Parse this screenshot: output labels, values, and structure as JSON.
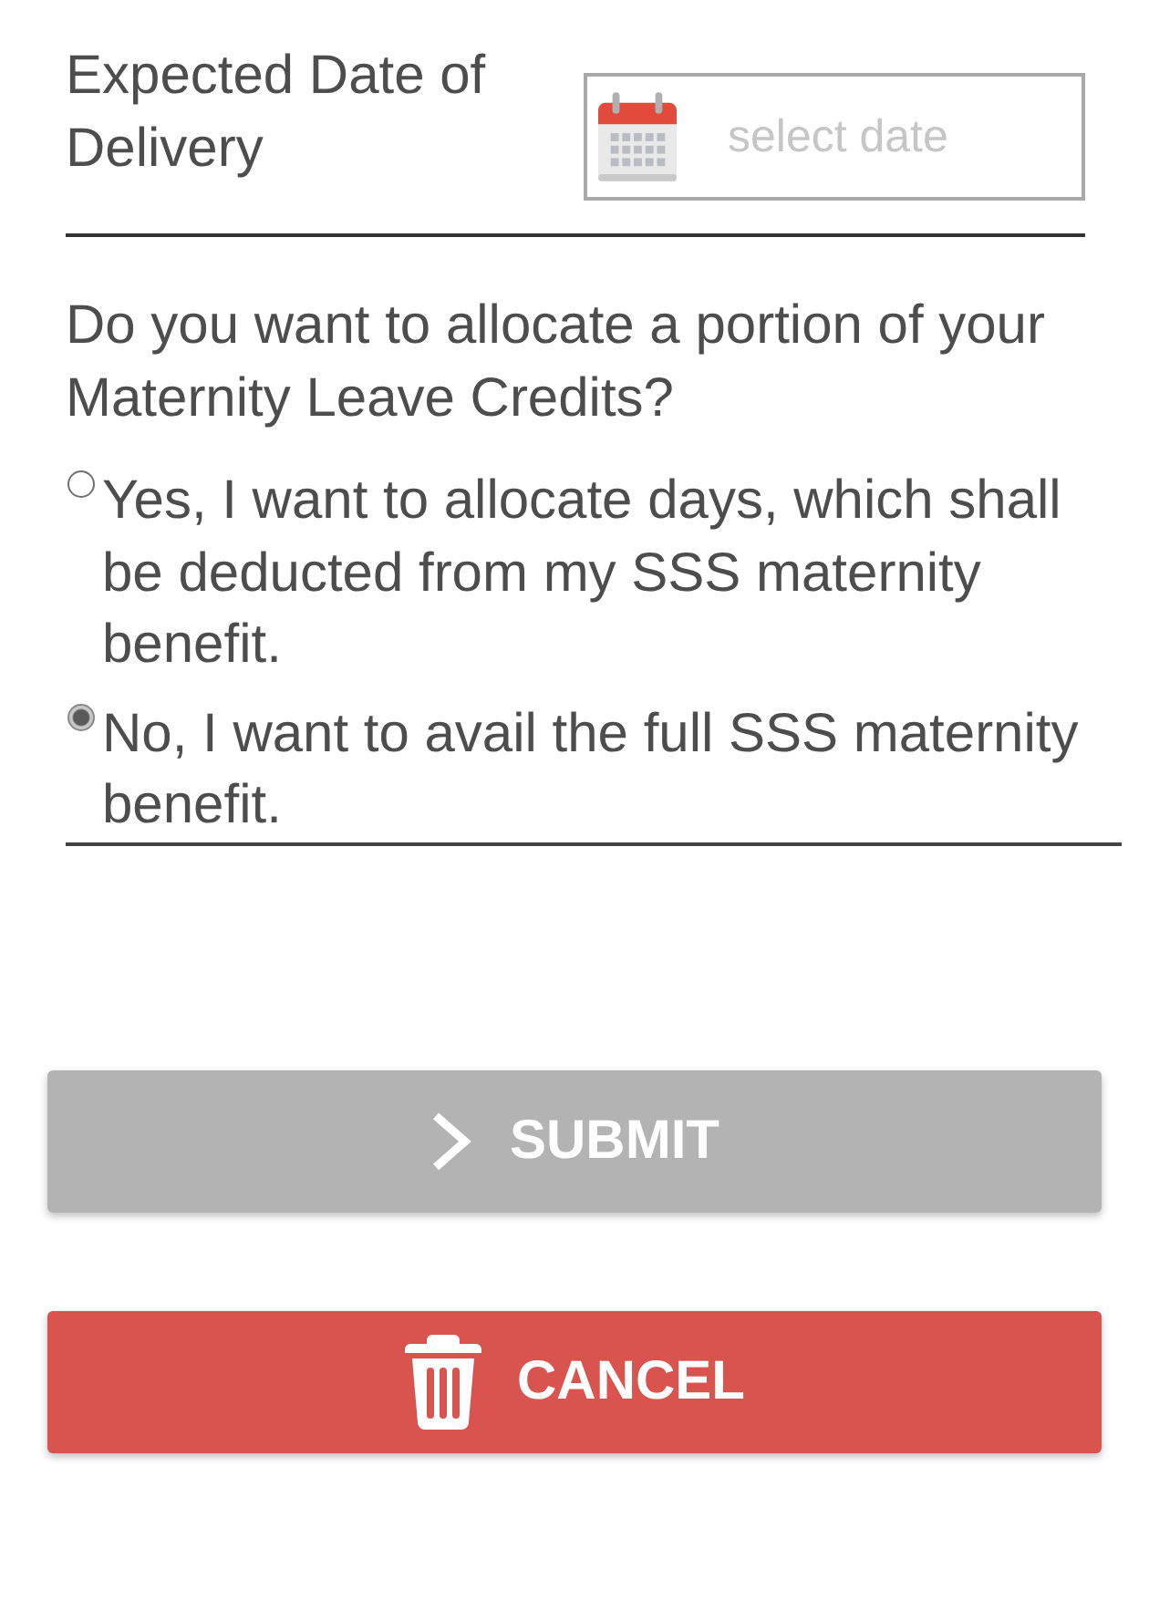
{
  "delivery_date": {
    "label": "Expected Date of Delivery",
    "placeholder": "select date"
  },
  "question": {
    "text": "Do you want to allocate a portion of your Maternity Leave Credits?",
    "options": [
      {
        "label": "Yes, I want to allocate days, which shall be deducted from my SSS maternity benefit.",
        "selected": false
      },
      {
        "label": "No, I want to avail the full SSS maternity benefit.",
        "selected": true
      }
    ]
  },
  "buttons": [
    {
      "kind": "submit",
      "label": "SUBMIT",
      "disabled": true
    },
    {
      "kind": "cancel",
      "label": "CANCEL",
      "disabled": false
    }
  ]
}
